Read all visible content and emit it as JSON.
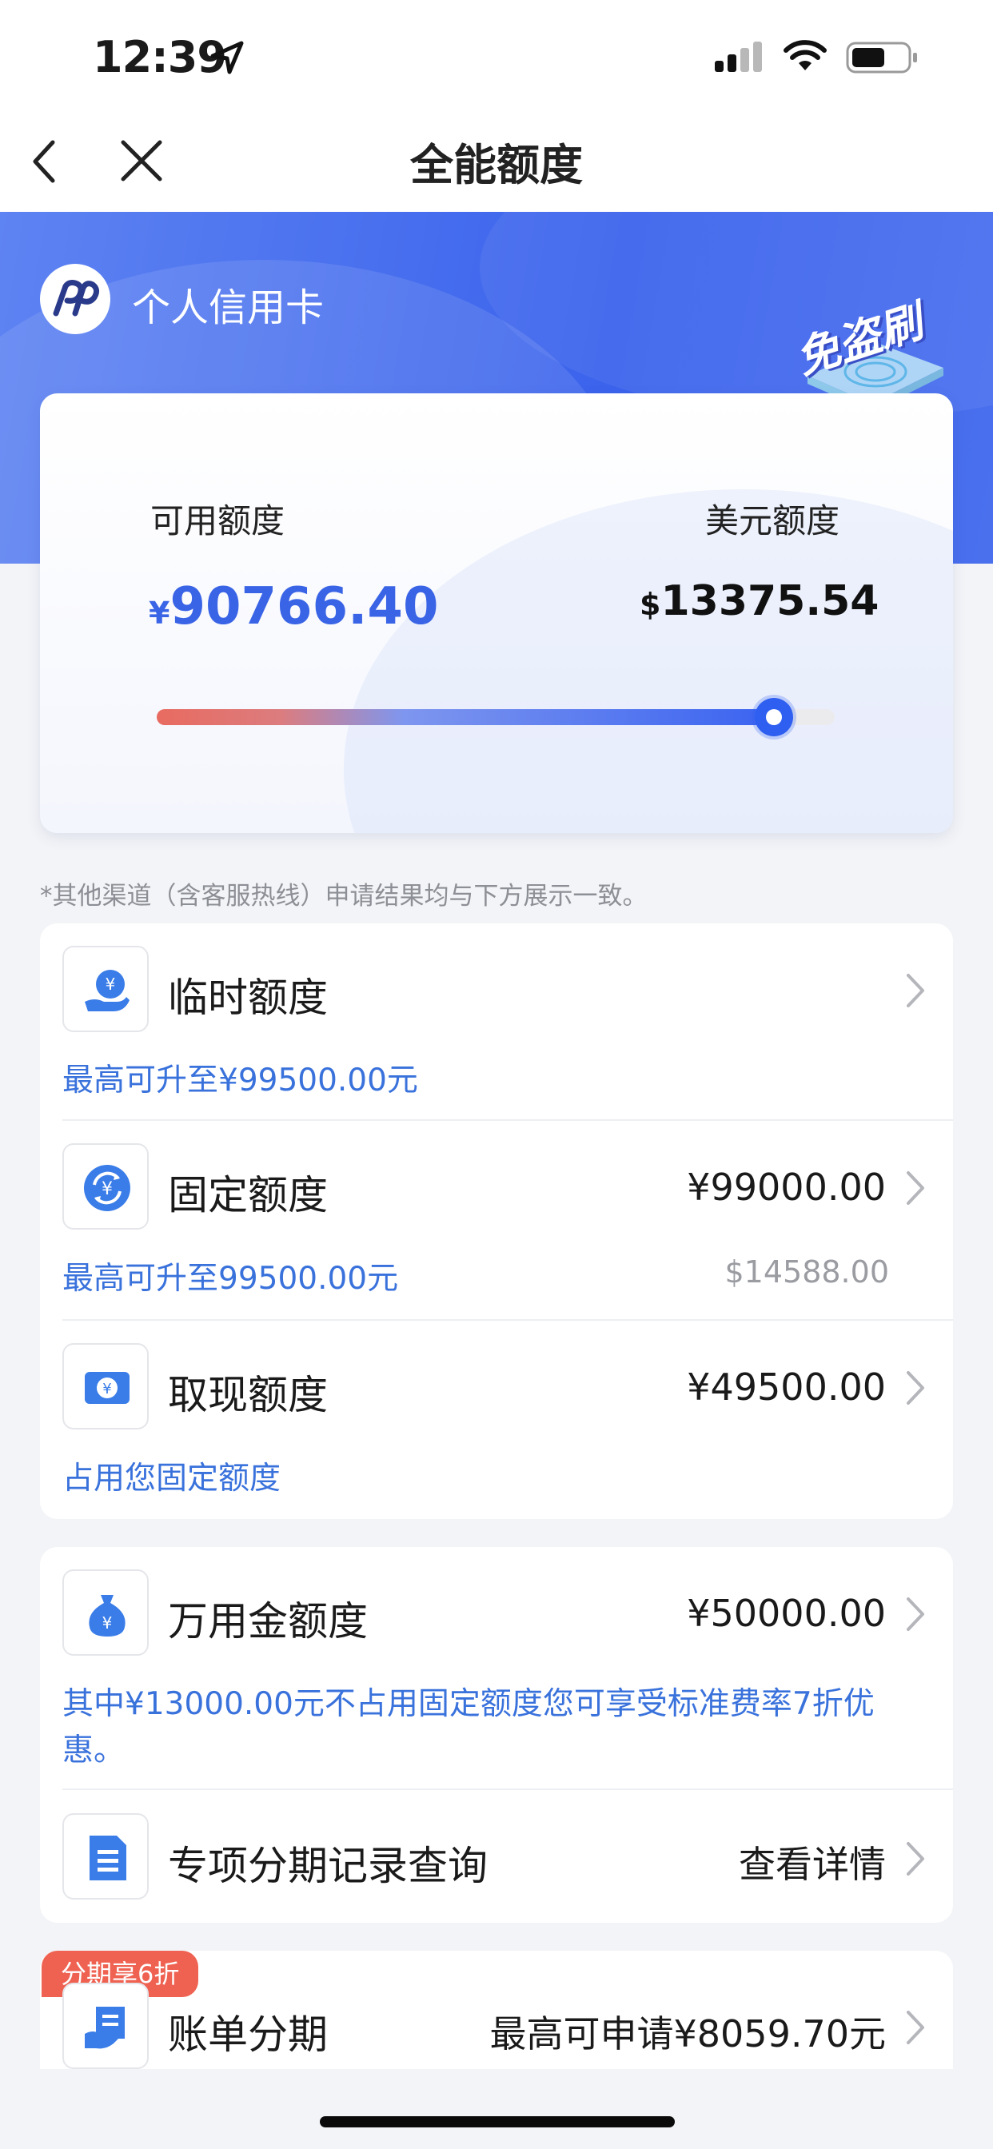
{
  "status_bar": {
    "time": "12:39"
  },
  "nav": {
    "title": "全能额度"
  },
  "card_header": {
    "name": "个人信用卡",
    "badge_text": "免盗刷"
  },
  "limits": {
    "available_label": "可用额度",
    "available_symbol": "¥",
    "available_amount": "90766.40",
    "usd_label": "美元额度",
    "usd_symbol": "$",
    "usd_amount": "13375.54",
    "usage_fraction": 0.91
  },
  "note": "*其他渠道（含客服热线）申请结果均与下方展示一致。",
  "section1": [
    {
      "title": "临时额度",
      "value": "",
      "sub": "最高可升至¥99500.00元",
      "sub_right": "",
      "icon": "hand-yen-icon"
    },
    {
      "title": "固定额度",
      "value": "¥99000.00",
      "sub": "最高可升至99500.00元",
      "sub_right": "$14588.00",
      "icon": "cycle-yen-icon"
    },
    {
      "title": "取现额度",
      "value": "¥49500.00",
      "sub": "占用您固定额度",
      "sub_right": "",
      "icon": "banknote-yen-icon"
    }
  ],
  "section2": [
    {
      "title": "万用金额度",
      "value": "¥50000.00",
      "sub_line1": "其中¥13000.00元不占用固定额度您可享受标准费率7折优",
      "sub_line2": "惠。",
      "icon": "money-bag-icon"
    },
    {
      "title": "专项分期记录查询",
      "value": "查看详情",
      "icon": "document-icon"
    }
  ],
  "section3": {
    "promo": "分期享6折",
    "title": "账单分期",
    "value": "最高可申请¥8059.70元",
    "icon": "bill-installment-icon"
  },
  "colors": {
    "accent_blue": "#3a64e6",
    "link_blue": "#3a72dc",
    "promo_red": "#ef6252"
  }
}
